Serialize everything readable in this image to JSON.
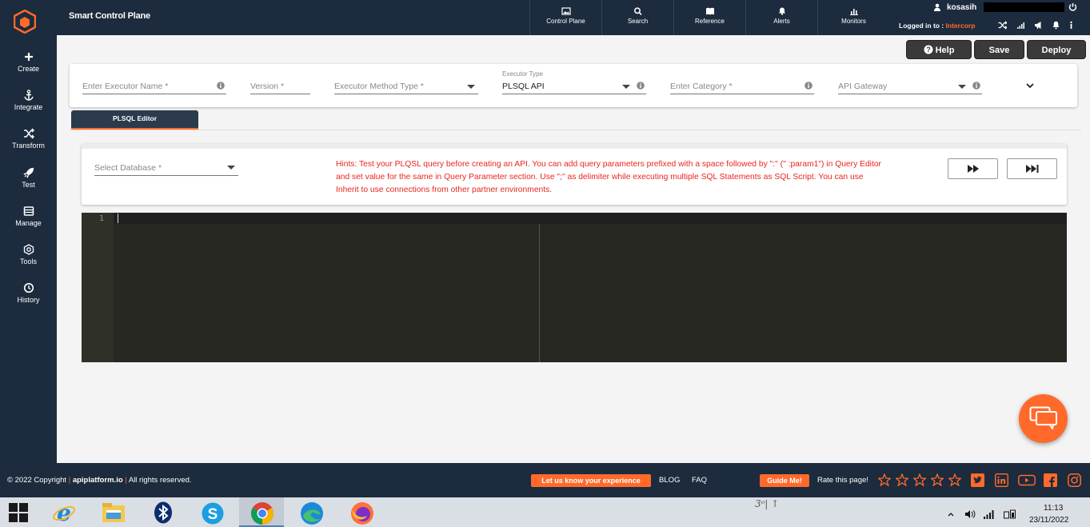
{
  "app": {
    "title": "Smart Control Plane"
  },
  "sidebar": {
    "items": [
      {
        "label": "Create",
        "icon": "plus-icon"
      },
      {
        "label": "Integrate",
        "icon": "anchor-icon"
      },
      {
        "label": "Transform",
        "icon": "shuffle-icon"
      },
      {
        "label": "Test",
        "icon": "rocket-icon"
      },
      {
        "label": "Manage",
        "icon": "list-icon"
      },
      {
        "label": "Tools",
        "icon": "tools-icon"
      },
      {
        "label": "History",
        "icon": "clock-icon"
      }
    ]
  },
  "header": {
    "nav": [
      {
        "label": "Control Plane",
        "icon": "image-icon"
      },
      {
        "label": "Search",
        "icon": "search-icon"
      },
      {
        "label": "Reference",
        "icon": "book-icon"
      },
      {
        "label": "Alerts",
        "icon": "bell-icon"
      },
      {
        "label": "Monitors",
        "icon": "bar-chart-icon"
      }
    ],
    "user": "kosasih",
    "logged_in_prefix": "Logged in to : ",
    "org": "Intercorp"
  },
  "actions": {
    "help": "Help",
    "save": "Save",
    "deploy": "Deploy"
  },
  "form": {
    "executor_name_placeholder": "Enter Executor Name *",
    "version_placeholder": "Version *",
    "method_type_placeholder": "Executor Method Type *",
    "executor_type_label": "Executor Type",
    "executor_type_value": "PLSQL API",
    "category_placeholder": "Enter Category *",
    "gateway_placeholder": "API Gateway"
  },
  "tabs": [
    {
      "label": "PLSQL Editor",
      "active": true
    }
  ],
  "database": {
    "placeholder": "Select Database *",
    "hints": "Hints: Test your PLQSL query before creating an API. You can add query parameters prefixed with a space followed by \":\" (\" :param1\") in Query Editor and set value for the same in Query Parameter section. Use \";\" as delimiter while executing multiple SQL Statements as SQL Script. You can use Inherit to use connections from other partner environments."
  },
  "editor": {
    "line_number": "1"
  },
  "footer": {
    "copyright_prefix": "© 2022 Copyright ",
    "site": "apiplatform.io",
    "rights": " All rights reserved.",
    "feedback": "Let us know your experience",
    "blog": "BLOG",
    "faq": "FAQ",
    "guide": "Guide Me!",
    "rate": "Rate this page!"
  },
  "taskbar": {
    "apps": [
      "windows-start",
      "internet-explorer",
      "file-explorer",
      "bluetooth",
      "skype",
      "chrome",
      "edge",
      "firefox"
    ],
    "time": "11:13",
    "date": "23/11/2022",
    "handwriting": "3ᵒ| ↑"
  },
  "colors": {
    "navy": "#1c2b3d",
    "accent": "#ff6a2b",
    "hint_red": "#e8261f",
    "editor_bg": "#272822"
  }
}
